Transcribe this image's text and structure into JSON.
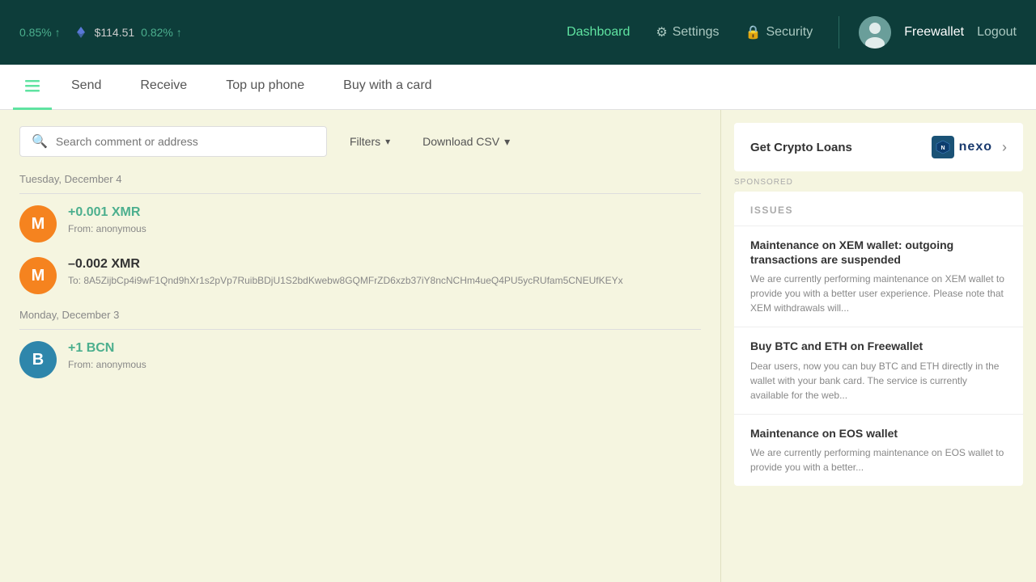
{
  "header": {
    "price1_pct": "0.85% ↑",
    "eth_price": "$114.51",
    "price2_pct": "0.82% ↑",
    "nav": {
      "dashboard": "Dashboard",
      "settings": "Settings",
      "security": "Security"
    },
    "username": "Freewallet",
    "logout": "Logout"
  },
  "tabs": {
    "send": "Send",
    "receive": "Receive",
    "top_up_phone": "Top up phone",
    "buy_with_card": "Buy with a card"
  },
  "search": {
    "placeholder": "Search comment or address"
  },
  "filters": {
    "filters_label": "Filters",
    "csv_label": "Download CSV"
  },
  "transactions": [
    {
      "date": "Tuesday, December 4",
      "items": [
        {
          "icon": "M",
          "color": "orange",
          "amount": "+0.001 XMR",
          "amount_type": "pos",
          "sub": "From: anonymous"
        },
        {
          "icon": "M",
          "color": "orange",
          "amount": "–0.002 XMR",
          "amount_type": "neg",
          "sub": "To: 8A5ZijbCp4i9wF1Qnd9hXr1s2pVp7RuibBDjU1S2bdKwebw8GQMFrZD6xzb37iY8ncNCHm4ueQ4PU5ycRUfam5CNEUfKEYx"
        }
      ]
    },
    {
      "date": "Monday, December 3",
      "items": [
        {
          "icon": "B",
          "color": "teal",
          "amount": "+1 BCN",
          "amount_type": "pos",
          "sub": "From: anonymous"
        }
      ]
    }
  ],
  "promo": {
    "text": "Get Crypto Loans",
    "brand": "nexo",
    "sponsored": "SPONSORED"
  },
  "issues": {
    "header": "ISSUES",
    "items": [
      {
        "title": "Maintenance on XEM wallet: outgoing transactions are suspended",
        "desc": "We are currently performing maintenance on XEM wallet to provide you with a better user experience. Please note that XEM withdrawals will..."
      },
      {
        "title": "Buy BTC and ETH on Freewallet",
        "desc": "Dear users, now you can buy BTC and ETH directly in the wallet with your bank card. The service is currently available for the web..."
      },
      {
        "title": "Maintenance on EOS wallet",
        "desc": "We are currently performing maintenance on EOS wallet to provide you with a better..."
      }
    ]
  }
}
